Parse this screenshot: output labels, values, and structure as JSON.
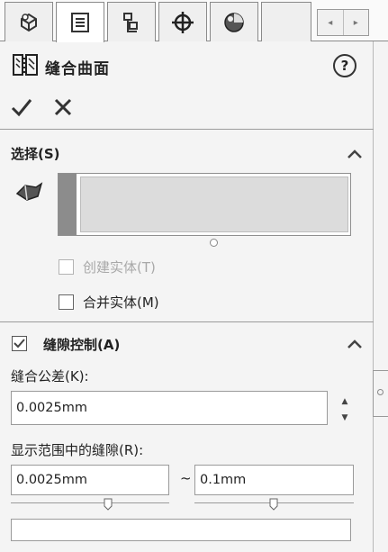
{
  "tabs": [
    {
      "name": "featuremanager",
      "icon": "feature-tree-icon"
    },
    {
      "name": "propertymanager",
      "icon": "property-manager-icon",
      "active": true
    },
    {
      "name": "configurationmanager",
      "icon": "configuration-icon"
    },
    {
      "name": "dimxpertmanager",
      "icon": "crosshair-icon"
    },
    {
      "name": "displaymanager",
      "icon": "appearance-sphere-icon"
    }
  ],
  "header": {
    "title": "缝合曲面",
    "title_icon": "knit-surface-icon",
    "help_label": "?",
    "ok_icon": "checkmark-icon",
    "cancel_icon": "close-icon"
  },
  "selection": {
    "title": "选择(S)",
    "selector_icon": "face-selector-icon",
    "create_solid_label": "创建实体(T)",
    "create_solid_checked": false,
    "create_solid_enabled": false,
    "merge_label": "合并实体(M)",
    "merge_checked": false
  },
  "gap_control": {
    "title": "缝隙控制(A)",
    "checked": true,
    "tolerance_label": "缝合公差(K):",
    "tolerance_value": "0.0025mm",
    "range_label": "显示范围中的缝隙(R):",
    "range_min": "0.0025mm",
    "range_separator": "~",
    "range_max": "0.1mm",
    "gap_list": ""
  },
  "colors": {
    "background": "#f4f4f4",
    "border": "#9a9a9a",
    "selection_field": "#dcdcdc",
    "disabled_text": "#a8a8a8"
  }
}
